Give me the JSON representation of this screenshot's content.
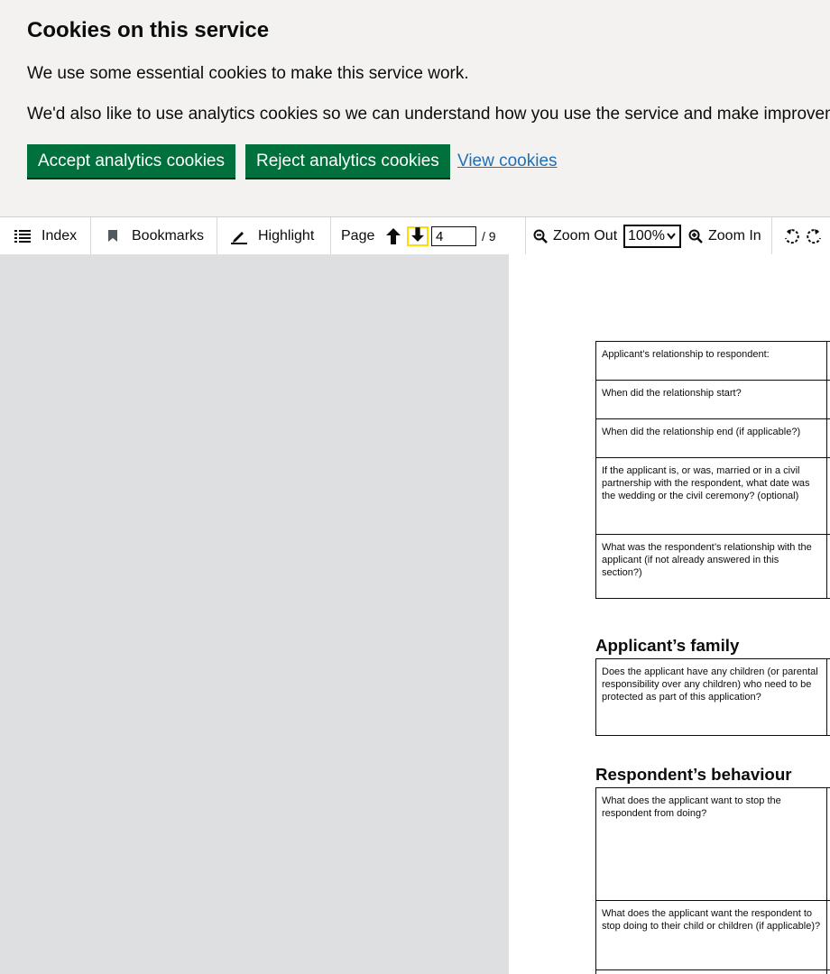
{
  "cookie_banner": {
    "heading": "Cookies on this service",
    "para1": "We use some essential cookies to make this service work.",
    "para2": "We'd also like to use analytics cookies so we can understand how you use the service and make improvements.",
    "accept_label": "Accept analytics cookies",
    "reject_label": "Reject analytics cookies",
    "view_label": "View cookies"
  },
  "toolbar": {
    "index_label": "Index",
    "bookmarks_label": "Bookmarks",
    "highlight_label": "Highlight",
    "page_label": "Page",
    "page_value": "4",
    "page_total": "/ 9",
    "zoom_out_label": "Zoom Out",
    "zoom_value": "100%",
    "zoom_in_label": "Zoom In"
  },
  "document": {
    "relationship_rows": [
      "Applicant’s relationship to respondent:",
      "When did the relationship start?",
      "When did the relationship end (if applicable?)",
      "If the applicant is, or was, married or in a civil partnership with the respondent, what date was the wedding or the civil ceremony? (optional)",
      "What was the respondent’s relationship with the applicant (if not already answered in this section?)"
    ],
    "family_heading": "Applicant’s family",
    "family_rows": [
      "Does the applicant have any children (or parental responsibility over any children) who need to be protected as part of this application?"
    ],
    "behaviour_heading": "Respondent’s behaviour",
    "behaviour_rows": [
      "What does the applicant want to stop the respondent from doing?",
      "What does the applicant want the respondent to stop doing to their child or children (if applicable)?"
    ]
  }
}
